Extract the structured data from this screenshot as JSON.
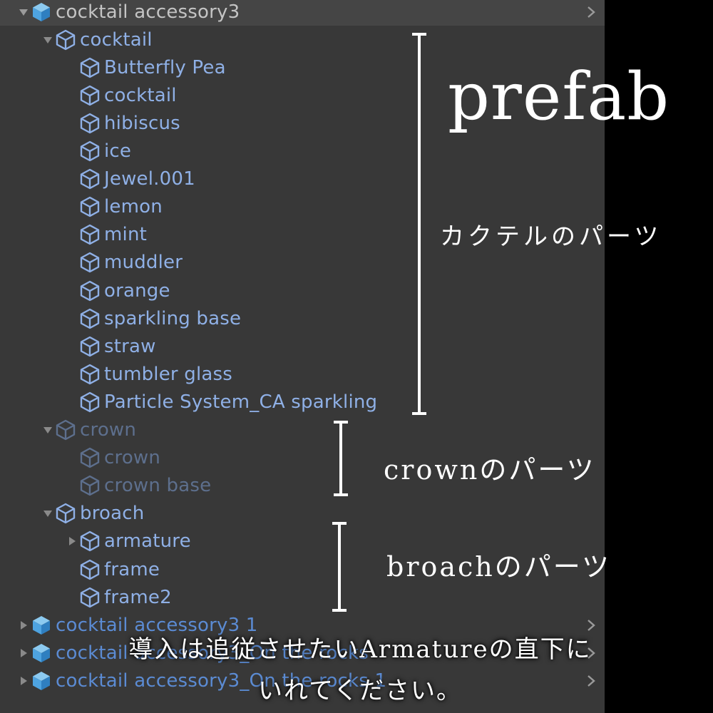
{
  "colors": {
    "background": "#383838",
    "header_row": "#454545",
    "item_text": "#8fb0e6",
    "inactive_text": "#5d6f8d",
    "root_icon": "#4ea3e0",
    "overlay_text": "#ffffff",
    "right_band": "#000000"
  },
  "hierarchy": {
    "root": {
      "label": "cocktail accessory3",
      "icon": "prefab-cube-icon",
      "expanded": true
    },
    "groups": [
      {
        "label": "cocktail",
        "icon": "cube-outline-icon",
        "expanded": true,
        "children": [
          "Butterfly Pea",
          "cocktail",
          "hibiscus",
          "ice",
          "Jewel.001",
          "lemon",
          "mint",
          "muddler",
          "orange",
          "sparkling base",
          "straw",
          "tumbler glass",
          "Particle System_CA sparkling"
        ]
      },
      {
        "label": "crown",
        "icon": "cube-outline-icon",
        "expanded": true,
        "inactive": true,
        "children": [
          "crown",
          "crown base"
        ]
      },
      {
        "label": "broach",
        "icon": "cube-outline-icon",
        "expanded": true,
        "children": [
          "armature",
          "frame",
          "frame2"
        ],
        "collapsible_children": [
          "armature"
        ]
      }
    ],
    "other_roots": [
      "cocktail accessory3 1",
      "cocktail accessory3_On the rocks",
      "cocktail accessory3_On the rocks 1"
    ]
  },
  "overlay": {
    "title": "prefab",
    "cocktail_note": "カクテルのパーツ",
    "crown_note": "crownのパーツ",
    "broach_note": "broachのパーツ",
    "instruction_line1": "導入は追従させたいArmatureの直下に",
    "instruction_line2": "いれてください。"
  }
}
